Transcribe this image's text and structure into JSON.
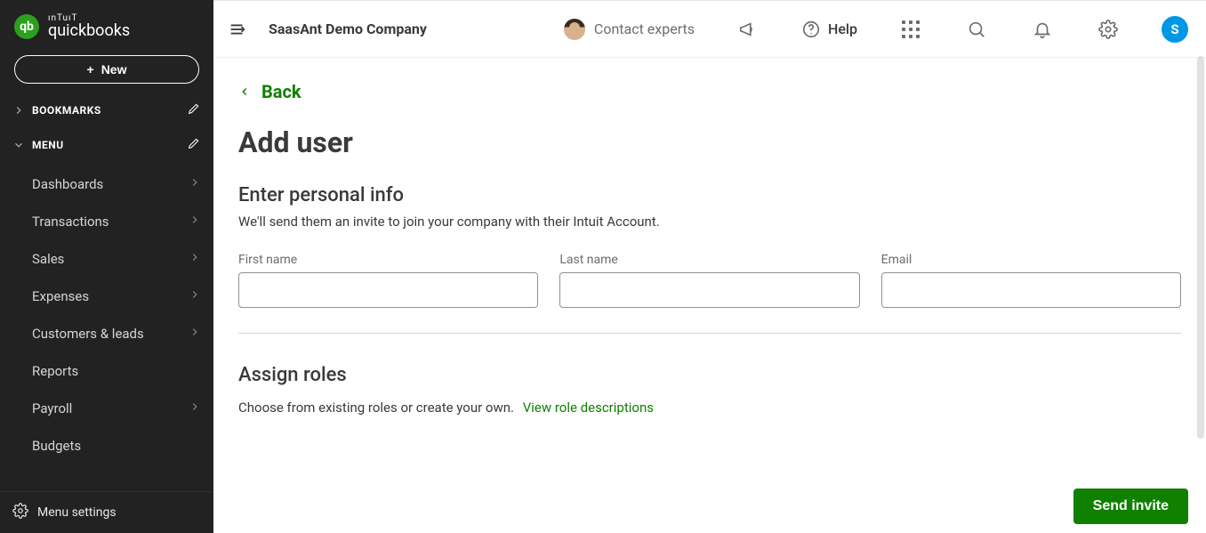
{
  "brand": {
    "top": "ınTuıT",
    "bottom": "quickbooks",
    "mark_text": "qb"
  },
  "sidebar": {
    "new_label": "New",
    "bookmarks_label": "BOOKMARKS",
    "menu_label": "MENU",
    "items": [
      {
        "label": "Dashboards",
        "has_children": true
      },
      {
        "label": "Transactions",
        "has_children": true
      },
      {
        "label": "Sales",
        "has_children": true
      },
      {
        "label": "Expenses",
        "has_children": true
      },
      {
        "label": "Customers & leads",
        "has_children": true
      },
      {
        "label": "Reports",
        "has_children": false
      },
      {
        "label": "Payroll",
        "has_children": true
      },
      {
        "label": "Budgets",
        "has_children": false
      }
    ],
    "menu_settings_label": "Menu settings"
  },
  "header": {
    "company_name": "SaasAnt Demo Company",
    "contact_experts": "Contact experts",
    "help_label": "Help",
    "profile_initial": "S"
  },
  "page": {
    "back_label": "Back",
    "title": "Add user",
    "personal_info_title": "Enter personal info",
    "personal_info_desc": "We'll send them an invite to join your company with their Intuit Account.",
    "fields": {
      "first_name": {
        "label": "First name",
        "value": ""
      },
      "last_name": {
        "label": "Last name",
        "value": ""
      },
      "email": {
        "label": "Email",
        "value": ""
      }
    },
    "roles_title": "Assign roles",
    "roles_desc": "Choose from existing roles or create your own.",
    "roles_link": "View role descriptions",
    "send_invite_label": "Send invite"
  }
}
